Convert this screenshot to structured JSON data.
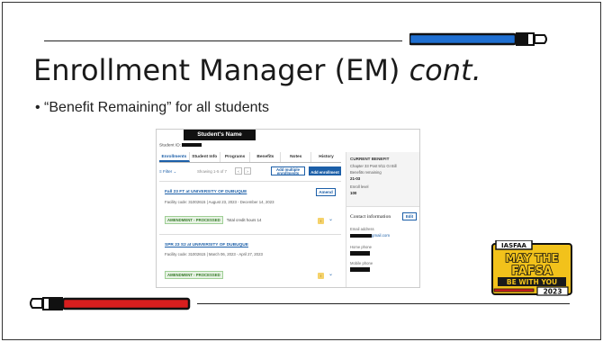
{
  "slide": {
    "title_main": "Enrollment Manager (EM) ",
    "title_italic": "cont.",
    "bullet": "• “Benefit Remaining” for all students"
  },
  "screenshot": {
    "header": "Student's Name",
    "student_id_label": "Student ID:",
    "tabs": [
      "Enrollments",
      "Student Info",
      "Programs",
      "Benefits",
      "Notes",
      "History"
    ],
    "filter_label": "Filter",
    "showing_text": "Showing 1-5 of 7",
    "page_prev": "‹",
    "page_next": "›",
    "add_multiple_line1": "Add multiple",
    "add_multiple_line2": "enrollments",
    "add_enrollment": "Add enrollment",
    "enrollments": [
      {
        "title": "Fall 23 FT at UNIVERSITY OF DUBUQUE",
        "facility": "Facility code: 31002615  |  August 23, 2023 - December 14, 2023",
        "status": "AMENDMENT - PROCESSED",
        "credit": "Total credit hours 14",
        "amend": "Amend"
      },
      {
        "title": "SPR 23 S2 at UNIVERSITY OF DUBUQUE",
        "facility": "Facility code: 31002615  |  March 06, 2023 - April 27, 2023",
        "status": "AMENDMENT - PROCESSED",
        "credit": ""
      }
    ],
    "right_panel": {
      "current_benefit_label": "CURRENT BENEFIT",
      "benefit_name": "Chapter 33 Post 9/11 GI Bill",
      "benefits_remaining_label": "Benefits remaining",
      "benefits_remaining_value": "21-03",
      "enroll_level_label": "Enroll level",
      "enroll_level_value": "100",
      "contact_title": "Contact information",
      "edit_label": "Edit",
      "email_label": "Email address",
      "email_suffix": "gmail.com",
      "home_phone_label": "Home phone",
      "mobile_phone_label": "Mobile phone"
    },
    "warn_glyph": "!",
    "chevron_glyph": "⌄"
  },
  "logo": {
    "top": "IASFAA",
    "line1": "MAY THE",
    "line2": "FAFSA",
    "line3": "BE WITH YOU",
    "year": "2023"
  },
  "colors": {
    "saber_blue": "#1f6fd1",
    "saber_red": "#d81e1e",
    "link_blue": "#1c5fa8",
    "logo_yellow": "#f2c21b"
  }
}
